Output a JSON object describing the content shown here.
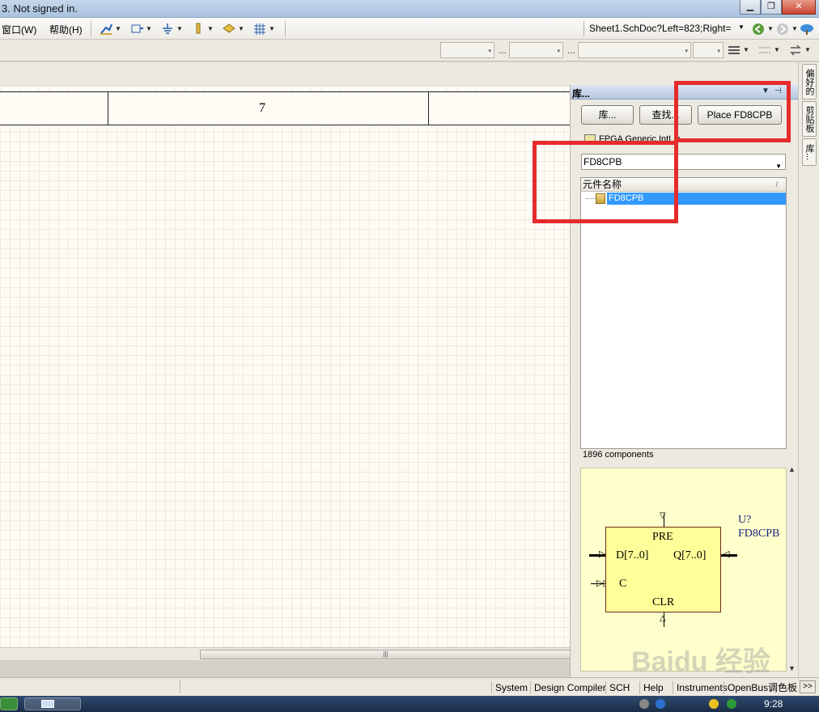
{
  "window": {
    "title": "3. Not signed in.",
    "buttons": {
      "minimize": "▁",
      "maximize": "❐",
      "close": "✕"
    }
  },
  "menu": {
    "window_label": "窗口(W)",
    "help_label": "帮助(H)"
  },
  "toolbar": {
    "icons": [
      "wire-icon",
      "bus-icon",
      "ground-icon",
      "power-port-icon",
      "net-label-icon",
      "grid-icon"
    ],
    "address": "Sheet1.SchDoc?Left=823;Right=",
    "dropdown_arrow": "▾",
    "ellipsis": "..."
  },
  "canvas": {
    "zone_number": "7",
    "scroll_grip": "|||"
  },
  "library_panel": {
    "title": "库...",
    "buttons": {
      "libraries": "库...",
      "search": "查找...",
      "place": "Place FD8CPB"
    },
    "selected_library": "FPGA Generic.IntLib",
    "filter_value": "FD8CPB",
    "list_header": "元件名称",
    "list_items": [
      "FD8CPB"
    ],
    "count": "1896 components",
    "preview": {
      "designator": "U?",
      "comment": "FD8CPB",
      "pins": {
        "top": "PRE",
        "data": "D[7..0]",
        "output": "Q[7..0]",
        "clock": "C",
        "bottom": "CLR"
      }
    }
  },
  "side_tabs": [
    "偏好的",
    "剪贴板",
    "库..."
  ],
  "status_bar": {
    "items": [
      "System",
      "Design Compiler",
      "SCH",
      "Help",
      "Instruments",
      "OpenBus调色板"
    ],
    "more": ">>"
  },
  "taskbar": {
    "time": "9:28"
  },
  "watermark": "Baidu 经验",
  "colors": {
    "highlight": "#e52b2b",
    "selection": "#3399ff",
    "preview_bg": "#ffffcc",
    "chip_fill": "#ffff99"
  }
}
